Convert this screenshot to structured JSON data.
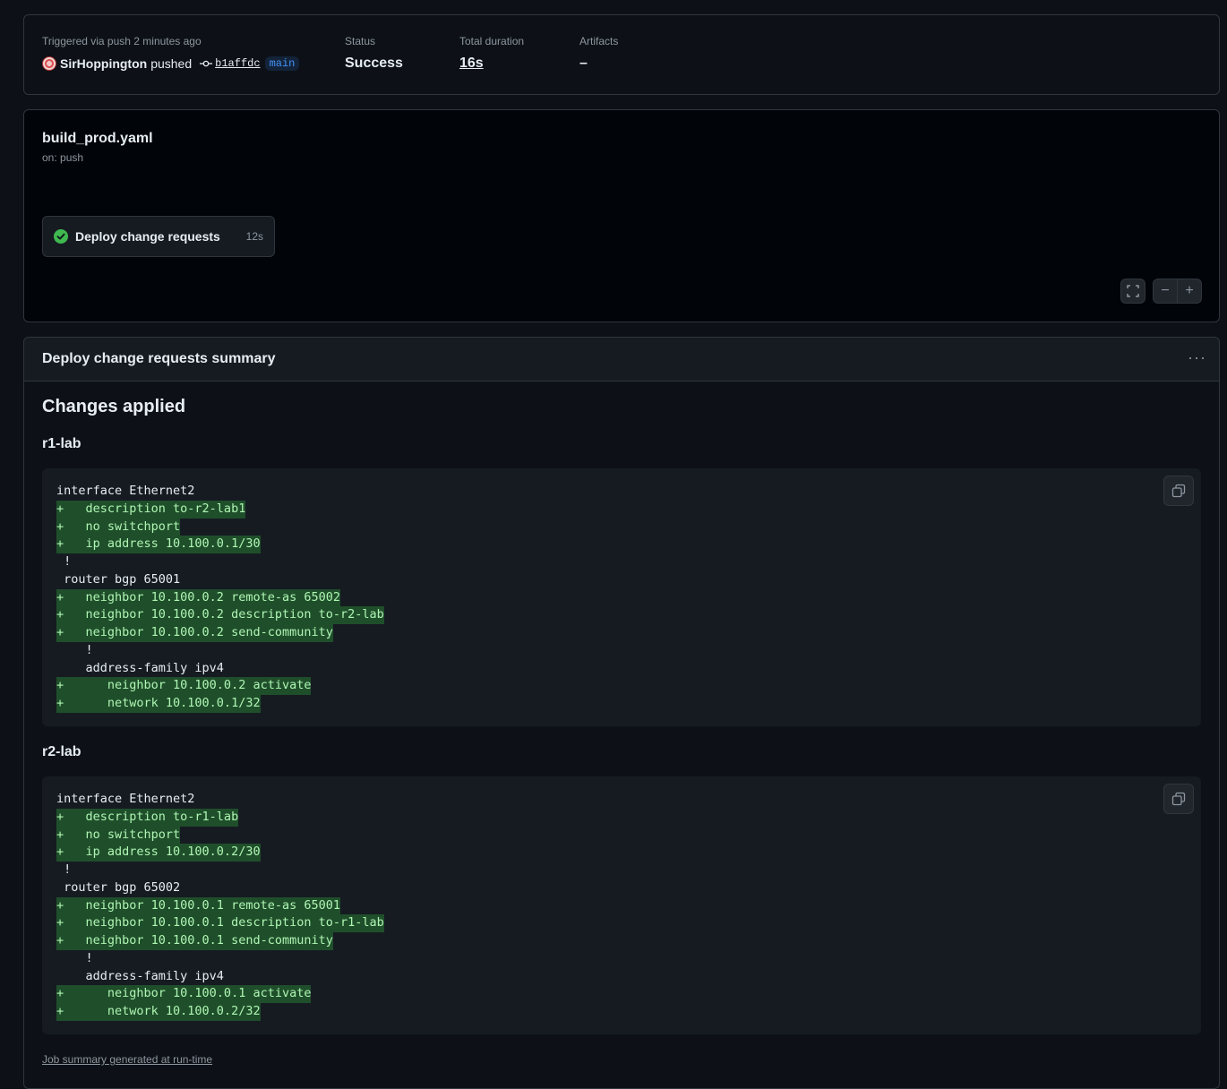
{
  "run": {
    "trigger_label": "Triggered via push 2 minutes ago",
    "actor": "SirHoppington",
    "action": "pushed",
    "commit_sha": "b1affdc",
    "branch": "main",
    "status_label": "Status",
    "status_value": "Success",
    "duration_label": "Total duration",
    "duration_value": "16s",
    "artifacts_label": "Artifacts",
    "artifacts_value": "–"
  },
  "workflow": {
    "file": "build_prod.yaml",
    "trigger": "on: push",
    "job": {
      "name": "Deploy change requests",
      "duration": "12s",
      "status": "success",
      "status_color": "#3fb950"
    },
    "controls": {
      "fullscreen_icon": "fullscreen-icon",
      "zoom_out": "−",
      "zoom_in": "+"
    }
  },
  "summary": {
    "title": "Deploy change requests summary",
    "menu_glyph": "···",
    "heading": "Changes applied",
    "devices": [
      {
        "name": "r1-lab",
        "lines": [
          {
            "text": "interface Ethernet2",
            "added": false
          },
          {
            "text": "+   description to-r2-lab1",
            "added": true
          },
          {
            "text": "+   no switchport",
            "added": true
          },
          {
            "text": "+   ip address 10.100.0.1/30",
            "added": true
          },
          {
            "text": " !",
            "added": false
          },
          {
            "text": " router bgp 65001",
            "added": false
          },
          {
            "text": "+   neighbor 10.100.0.2 remote-as 65002",
            "added": true
          },
          {
            "text": "+   neighbor 10.100.0.2 description to-r2-lab",
            "added": true
          },
          {
            "text": "+   neighbor 10.100.0.2 send-community",
            "added": true
          },
          {
            "text": "    !",
            "added": false
          },
          {
            "text": "    address-family ipv4",
            "added": false
          },
          {
            "text": "+      neighbor 10.100.0.2 activate",
            "added": true
          },
          {
            "text": "+      network 10.100.0.1/32",
            "added": true
          }
        ]
      },
      {
        "name": "r2-lab",
        "lines": [
          {
            "text": "interface Ethernet2",
            "added": false
          },
          {
            "text": "+   description to-r1-lab",
            "added": true
          },
          {
            "text": "+   no switchport",
            "added": true
          },
          {
            "text": "+   ip address 10.100.0.2/30",
            "added": true
          },
          {
            "text": " !",
            "added": false
          },
          {
            "text": " router bgp 65002",
            "added": false
          },
          {
            "text": "+   neighbor 10.100.0.1 remote-as 65001",
            "added": true
          },
          {
            "text": "+   neighbor 10.100.0.1 description to-r1-lab",
            "added": true
          },
          {
            "text": "+   neighbor 10.100.0.1 send-community",
            "added": true
          },
          {
            "text": "    !",
            "added": false
          },
          {
            "text": "    address-family ipv4",
            "added": false
          },
          {
            "text": "+      neighbor 10.100.0.1 activate",
            "added": true
          },
          {
            "text": "+      network 10.100.0.2/32",
            "added": true
          }
        ]
      }
    ],
    "footer": "Job summary generated at run-time"
  }
}
